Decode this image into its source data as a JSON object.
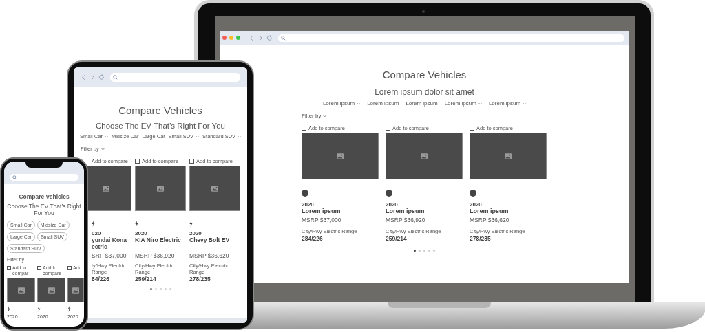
{
  "laptop_screen": {
    "title": "Compare Vehicles",
    "subtitle": "Lorem ipsum dolor sit amet",
    "categories": [
      {
        "label": "Lorem ipsum",
        "dropdown": true
      },
      {
        "label": "Lorem ipsum",
        "dropdown": false
      },
      {
        "label": "Lorem ipsum",
        "dropdown": false
      },
      {
        "label": "Lorem ipsum",
        "dropdown": true
      },
      {
        "label": "Lorem ipsum",
        "dropdown": true
      }
    ],
    "filter": {
      "label": "Filter by",
      "dropdown": true
    },
    "vehicles": [
      {
        "compare_label": "Add to compare",
        "checked": false,
        "year": "2020",
        "name_lines": [
          "Lorem ipsum"
        ],
        "msrp": "MSRP $37,000",
        "range_label": "City/Hwy Electric Range",
        "range": "284/226"
      },
      {
        "compare_label": "Add to compare",
        "checked": false,
        "year": "2020",
        "name_lines": [
          "Lorem ipsum"
        ],
        "msrp": "MSRP $36,920",
        "range_label": "City/Hwy Electric Range",
        "range": "259/214"
      },
      {
        "compare_label": "Add to compare",
        "checked": false,
        "year": "2020",
        "name_lines": [
          "Lorem ipsum"
        ],
        "msrp": "MSRP $36,620",
        "range_label": "City/Hwy Electric Range",
        "range": "278/235"
      }
    ],
    "pages": [
      {
        "selected": true
      },
      {
        "selected": false
      },
      {
        "selected": false
      },
      {
        "selected": false
      },
      {
        "selected": false
      }
    ]
  },
  "tablet_screen": {
    "title": "Compare Vehicles",
    "subtitle": "Choose The EV That’s Right For You",
    "categories": [
      {
        "label": "Small Car",
        "dropdown": true
      },
      {
        "label": "Midsize Car",
        "dropdown": false
      },
      {
        "label": "Large Car",
        "dropdown": false
      },
      {
        "label": "Small SUV",
        "dropdown": true
      },
      {
        "label": "Standard SUV",
        "dropdown": true
      }
    ],
    "filter": {
      "label": "Filter by",
      "dropdown": true
    },
    "vehicles": [
      {
        "compare_label": "Add to compare",
        "year": "020",
        "name_lines": [
          "yundai Kona",
          "ectric"
        ],
        "msrp": "SRP $37,000",
        "range_label": "ty/Hwy Electric Range",
        "range": "84/226"
      },
      {
        "compare_label": "Add to compare",
        "checked": false,
        "year": "2020",
        "name_lines": [
          "KIA Niro Electric"
        ],
        "msrp": "MSRP $36,920",
        "range_label": "City/Hwy Electric Range",
        "range": "259/214"
      },
      {
        "compare_label": "Add to compare",
        "checked": false,
        "year": "2020",
        "name_lines": [
          "Chevy Bolt EV"
        ],
        "msrp": "MSRP $36,620",
        "range_label": "City/Hwy Electric Range",
        "range": "278/235"
      }
    ],
    "pages": [
      {
        "selected": true
      },
      {
        "selected": false
      },
      {
        "selected": false
      },
      {
        "selected": false
      },
      {
        "selected": false
      }
    ]
  },
  "phone_screen": {
    "title": "Compare Vehicles",
    "subtitle": "Choose The EV That’s Right For You",
    "categories": [
      {
        "label": "Small Car"
      },
      {
        "label": "Midsize Car"
      },
      {
        "label": "Large Car"
      },
      {
        "label": "Small SUV"
      },
      {
        "label": "Standard SUV"
      }
    ],
    "filter": {
      "label": "Filter by"
    },
    "vehicles": [
      {
        "compare_label": "Add to compar",
        "checked": false,
        "year": "2020"
      },
      {
        "compare_label": "Add to compare",
        "checked": false,
        "year": "2020"
      },
      {
        "compare_label": "Add",
        "checked": false,
        "year": "2020"
      }
    ]
  }
}
